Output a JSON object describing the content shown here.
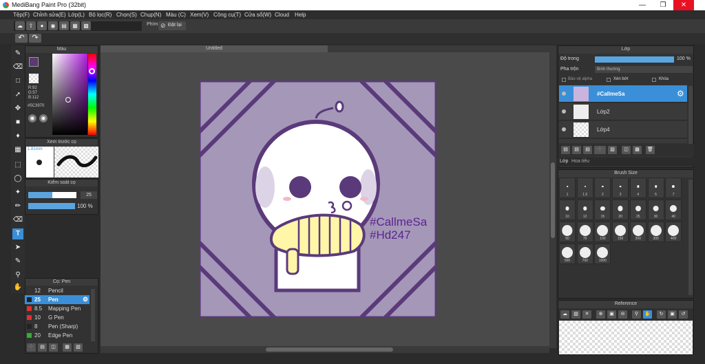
{
  "window": {
    "title": "MediBang Paint Pro (32bit)"
  },
  "menu": [
    "Tệp(F)",
    "Chỉnh sửa(E)",
    "Lớp(L)",
    "Bộ lọc(R)",
    "Chọn(S)",
    "Chụp(N)",
    "Màu (C)",
    "Xem(V)",
    "Công cụ(T)",
    "Cửa sổ(W)",
    "Cloud",
    "Help"
  ],
  "toolbar": {
    "phim_label": "Phím",
    "reset_label": "Đặt lại"
  },
  "color_panel": {
    "title": "Màu",
    "r": "R:92",
    "g": "G:57",
    "b": "B:112",
    "hex": "#5C3970",
    "main_color": "#5c3970"
  },
  "brush_preview": {
    "title": "Xem trước cọ",
    "size": "1.81mm"
  },
  "brush_control": {
    "title": "Kiểm soát cọ",
    "size_value": "25",
    "opacity_value": "100 %"
  },
  "brush_list": {
    "title": "Cọ: Pen",
    "items": [
      {
        "size": "12",
        "name": "Pencil",
        "color": "#333333"
      },
      {
        "size": "25",
        "name": "Pen",
        "color": "#222222"
      },
      {
        "size": "8.5",
        "name": "Mapping Pen",
        "color": "#e03030"
      },
      {
        "size": "10",
        "name": "G Pen",
        "color": "#e03030"
      },
      {
        "size": "8",
        "name": "Pen (Sharp)",
        "color": "#222222"
      },
      {
        "size": "20",
        "name": "Edge Pen",
        "color": "#30b030"
      }
    ],
    "selected": 1
  },
  "canvas": {
    "tab_title": "Untitled",
    "text_line1": "#CallmeSa",
    "text_line2": "#Hd247"
  },
  "layer_panel": {
    "title": "Lớp",
    "opacity_label": "Độ trong",
    "opacity_value": "100 %",
    "blend_label": "Pha trộn",
    "blend_value": "Bình thường",
    "protect_alpha": "Bảo vệ alpha",
    "clip": "Xén bớt",
    "lock": "Khóa",
    "layers": [
      "#CallmeSa",
      "Lớp2",
      "Lớp4"
    ],
    "tabs": [
      "Lớp",
      "Hoa tiêu"
    ]
  },
  "brush_size": {
    "title": "Brush Size",
    "sizes": [
      "1",
      "1.5",
      "2",
      "3",
      "4",
      "5",
      "7",
      "10",
      "12",
      "15",
      "20",
      "25",
      "30",
      "40",
      "50",
      "70",
      "100",
      "150",
      "200",
      "300",
      "400",
      "500",
      "700",
      "1000"
    ]
  },
  "reference": {
    "title": "Reference"
  }
}
